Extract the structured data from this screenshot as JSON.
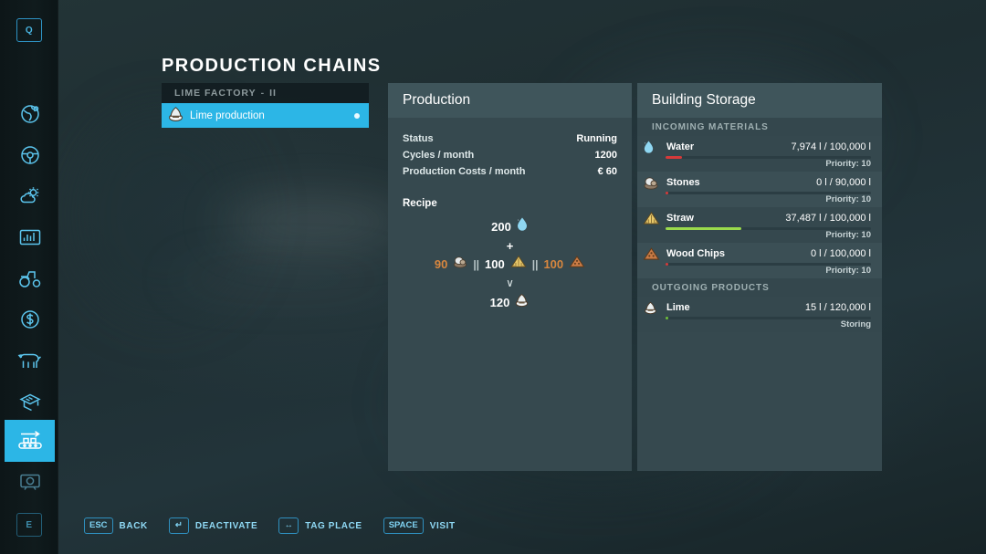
{
  "page_title": "PRODUCTION CHAINS",
  "sidebar": {
    "top_key": "Q",
    "bottom_key": "E",
    "items": [
      {
        "name": "map",
        "icon": "globe-icon"
      },
      {
        "name": "vehicles",
        "icon": "steering-wheel-icon"
      },
      {
        "name": "weather",
        "icon": "weather-icon"
      },
      {
        "name": "statistics",
        "icon": "statistics-icon"
      },
      {
        "name": "fields",
        "icon": "tractor-icon"
      },
      {
        "name": "finances",
        "icon": "dollar-icon"
      },
      {
        "name": "animals",
        "icon": "cow-icon"
      },
      {
        "name": "contracts",
        "icon": "documents-icon"
      },
      {
        "name": "production-chains",
        "icon": "conveyor-icon",
        "active": true
      },
      {
        "name": "radio",
        "icon": "radio-icon"
      }
    ]
  },
  "chain_list": {
    "group_header": {
      "title": "LIME FACTORY",
      "separator": "-",
      "suffix": "II"
    },
    "rows": [
      {
        "label": "Lime production",
        "icon": "lime-icon",
        "selected": true,
        "status_dot": true
      }
    ]
  },
  "production": {
    "header": "Production",
    "stats": [
      {
        "label": "Status",
        "value": "Running"
      },
      {
        "label": "Cycles / month",
        "value": "1200"
      },
      {
        "label": "Production Costs / month",
        "value": "€ 60"
      }
    ],
    "recipe": {
      "title": "Recipe",
      "inputs_primary": [
        {
          "amount": "200",
          "icon": "water-drop-icon",
          "state": "ok"
        }
      ],
      "plus": "+",
      "inputs_alternatives": [
        {
          "amount": "90",
          "icon": "stones-icon",
          "state": "low"
        },
        {
          "amount": "100",
          "icon": "straw-icon",
          "state": "ok"
        },
        {
          "amount": "100",
          "icon": "wood-chips-icon",
          "state": "low"
        }
      ],
      "alt_separator": "||",
      "arrow": "∨",
      "outputs": [
        {
          "amount": "120",
          "icon": "lime-icon",
          "state": "ok"
        }
      ]
    }
  },
  "storage": {
    "header": "Building Storage",
    "sections": [
      {
        "label": "INCOMING MATERIALS",
        "rows": [
          {
            "name": "Water",
            "icon": "water-drop-icon",
            "amount": "7,974 l / 100,000 l",
            "fill_pct": 8,
            "bar_color": "#d63a3a",
            "sub": "Priority: 10"
          },
          {
            "name": "Stones",
            "icon": "stones-icon",
            "amount": "0 l / 90,000 l",
            "fill_pct": 1,
            "bar_color": "#d63a3a",
            "sub": "Priority: 10"
          },
          {
            "name": "Straw",
            "icon": "straw-icon",
            "amount": "37,487 l / 100,000 l",
            "fill_pct": 37,
            "bar_color": "#9ada4c",
            "sub": "Priority: 10"
          },
          {
            "name": "Wood Chips",
            "icon": "wood-chips-icon",
            "amount": "0 l / 100,000 l",
            "fill_pct": 1,
            "bar_color": "#d63a3a",
            "sub": "Priority: 10"
          }
        ]
      },
      {
        "label": "OUTGOING PRODUCTS",
        "rows": [
          {
            "name": "Lime",
            "icon": "lime-icon",
            "amount": "15 l / 120,000 l",
            "fill_pct": 1,
            "bar_color": "#6fbf3a",
            "sub": "Storing"
          }
        ]
      }
    ]
  },
  "helpbar": [
    {
      "key": "ESC",
      "label": "BACK"
    },
    {
      "key": "↵",
      "label": "DEACTIVATE"
    },
    {
      "key": "↔",
      "label": "TAG PLACE"
    },
    {
      "key": "SPACE",
      "label": "VISIT"
    }
  ],
  "colors": {
    "accent": "#2cb6e6",
    "panel": "#36494f",
    "panel_header": "#3f555b",
    "low_amount": "#d8873f",
    "bar_green": "#9ada4c",
    "bar_red": "#d63a3a"
  }
}
